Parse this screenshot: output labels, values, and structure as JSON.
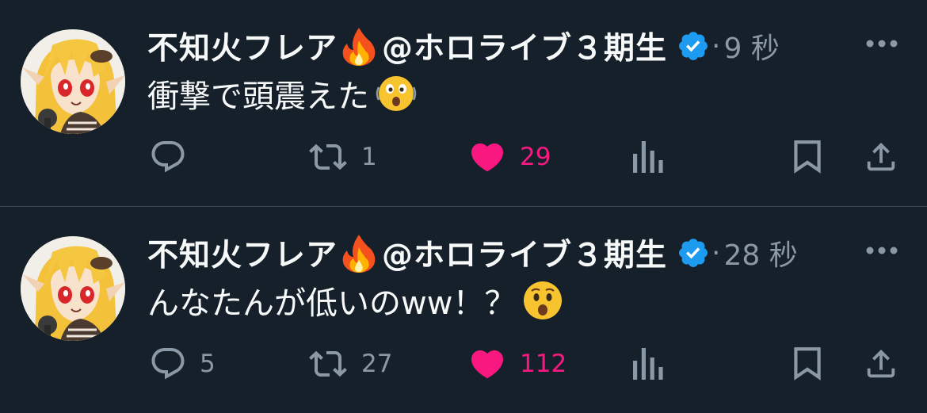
{
  "colors": {
    "background": "#15202b",
    "text": "#f7f9f9",
    "secondary": "#8b98a5",
    "like": "#f91880",
    "verified": "#1d9bf0",
    "divider": "#38444d"
  },
  "tweets": [
    {
      "author_name": "不知火フレア",
      "author_emoji_icon": "fire-icon",
      "author_handle": "@ホロライブ３期生",
      "separator": "·",
      "time": "9 秒",
      "text": "衝撃で頭震えた",
      "text_emoji_icon": "shaking-face-emoji",
      "reply_count": "",
      "retweet_count": "1",
      "like_count": "29",
      "liked": true
    },
    {
      "author_name": "不知火フレア",
      "author_emoji_icon": "fire-icon",
      "author_handle": "@ホロライブ３期生",
      "separator": "·",
      "time": "28 秒",
      "text": "んなたんが低いのww！？",
      "text_emoji_icon": "hushed-face-emoji",
      "reply_count": "5",
      "retweet_count": "27",
      "like_count": "112",
      "liked": true
    }
  ]
}
